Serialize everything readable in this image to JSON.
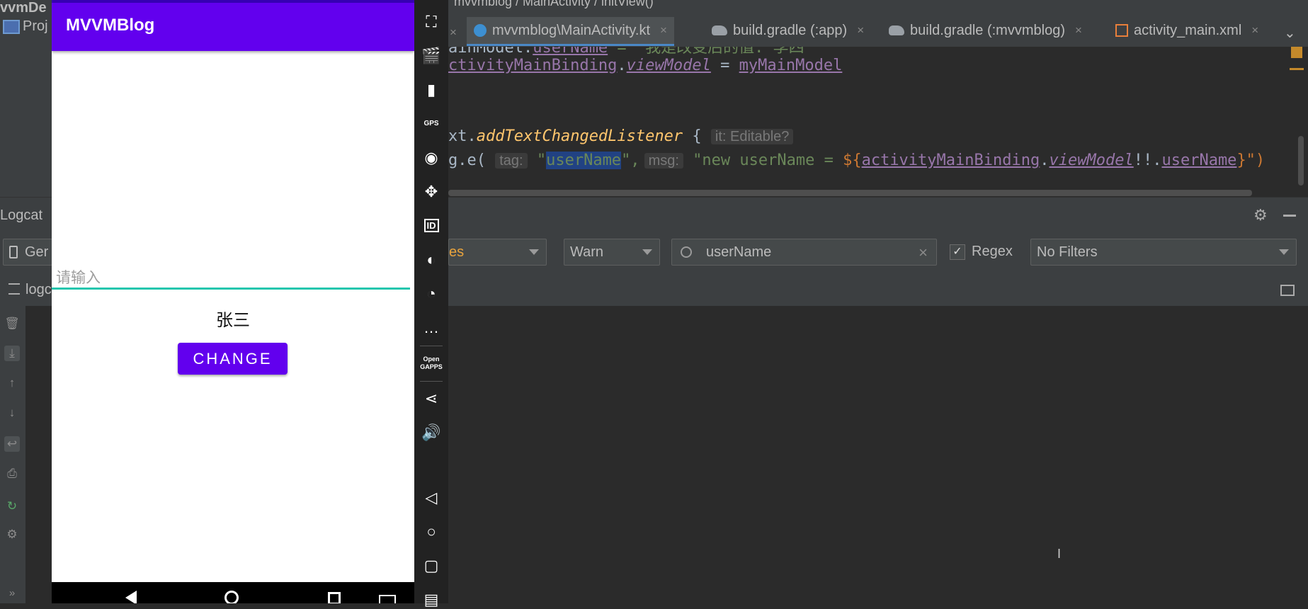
{
  "ide": {
    "breadcrumb": "mvvmblog  /  MainActivity  /  initView()",
    "project_label": "Proj",
    "left_truncated_title": "vvmDe",
    "tabs": [
      {
        "label": "mvvmblog\\MainActivity.kt",
        "active": true,
        "close": "×"
      },
      {
        "label": "build.gradle (:app)",
        "active": false,
        "close": "×"
      },
      {
        "label": "build.gradle (:mvvmblog)",
        "active": false,
        "close": "×"
      },
      {
        "label": "activity_main.xml",
        "active": false,
        "close": "×"
      }
    ],
    "tabs_overflow": "⌄",
    "code": {
      "line1_prefix": "ainModel.",
      "line1_field": "userName",
      "line1_rest": " = \"我是改变后的值: 李四\"",
      "line2_field": "ctivityMainBinding",
      "line2_dot": ".",
      "line2_prop": "viewModel",
      "line2_eq": " = ",
      "line2_val": "myMainModel",
      "line3_prefix": "xt.",
      "line3_fn": "addTextChangedListener",
      "line3_brace": " { ",
      "line3_hint": "it: Editable?",
      "line4_prefix": "g.e( ",
      "line4_hint_tag": "tag:",
      "line4_q1": " \"",
      "line4_sel": "userName",
      "line4_q2": "\",",
      "line4_hint_msg": "msg:",
      "line4_str": " \"new userName = ",
      "line4_tmpl": "${",
      "line4_ref1": "activityMainBinding",
      "line4_dot1": ".",
      "line4_ref2": "viewModel",
      "line4_bang": "!!.",
      "line4_ref3": "userName",
      "line4_end": "}\")"
    }
  },
  "logcat": {
    "title": "Logcat",
    "device_label": "Ger",
    "tab_label": "logc",
    "package_suffix": "es",
    "level": "Warn",
    "search_value": "userName",
    "search_clear": "×",
    "regex_label": "Regex",
    "regex_checked": true,
    "filter": "No Filters"
  },
  "emulator": {
    "app_title": "MVVMBlog",
    "input_placeholder": "请输入",
    "name_text": "张三",
    "button_label": "CHANGE",
    "colors": {
      "primary": "#6200ee",
      "primary_dark": "#3700b3",
      "accent": "#26c6ae"
    }
  },
  "emulator_toolbar": {
    "gps_label": "GPS",
    "id_label": "ID",
    "open_gapps_label": "Open GAPPS"
  },
  "colors": {
    "ide_bg": "#2b2b2b",
    "ide_panel": "#3c3f41",
    "code_default": "#a9b7c6"
  }
}
